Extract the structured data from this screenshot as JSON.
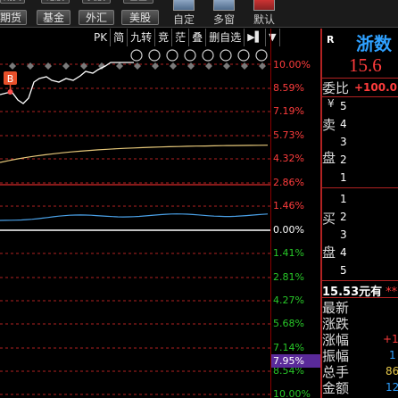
{
  "toolbar": {
    "top_buttons": [
      "期货",
      "港股",
      "美股",
      "基金"
    ],
    "market_buttons": [
      "期货",
      "基金",
      "外汇",
      "美股"
    ],
    "tools": [
      {
        "label": "自定",
        "icon": "custom-layout-icon"
      },
      {
        "label": "多窗",
        "icon": "multi-window-icon"
      },
      {
        "label": "默认",
        "icon": "default-layout-icon"
      }
    ]
  },
  "chart_tabs": [
    "PK",
    "简",
    "九转",
    "竞",
    "茫",
    "叠",
    "删自选",
    "▶▌",
    "▼"
  ],
  "chart_icons": [
    "eye-icon",
    "hand-icon",
    "play-icon",
    "undo-icon",
    "scissors-icon",
    "lock-icon",
    "zoom-in-icon",
    "zoom-out-icon"
  ],
  "marker_b": "B",
  "axis_pct_up": [
    "10.00%",
    "8.59%",
    "7.19%",
    "5.73%",
    "4.32%",
    "2.86%",
    "1.46%"
  ],
  "axis_pct_zero": "0.00%",
  "axis_pct_down": [
    "1.41%",
    "2.81%",
    "4.27%",
    "5.68%",
    "7.14%",
    "8.54%",
    "10.00%"
  ],
  "cursor_pct": "7.95%",
  "panel": {
    "r_label": "R",
    "stock_name": "浙数",
    "price": "15.6",
    "wei_bi_label": "委比",
    "wei_bi_value": "+100.0",
    "sell_labels": [
      "¥",
      "卖",
      "盘"
    ],
    "sell_levels": [
      "5",
      "4",
      "3",
      "2",
      "1"
    ],
    "buy_labels": [
      "买",
      "盘"
    ],
    "buy_levels": [
      "1",
      "2",
      "3",
      "4",
      "5"
    ],
    "limit_price": "15.53元有",
    "limit_stars": "**",
    "fields": [
      {
        "label": "最新",
        "value": ""
      },
      {
        "label": "涨跌",
        "value": ""
      },
      {
        "label": "涨幅",
        "value": "+1"
      },
      {
        "label": "振幅",
        "value": "1"
      },
      {
        "label": "总手",
        "value": "86"
      },
      {
        "label": "金额",
        "value": "12"
      }
    ]
  },
  "colors": {
    "up": "#ff3c3c",
    "down": "#28c828",
    "price_line": "#ffffff",
    "avg_line": "#e6c87a",
    "indicator_line": "#4aa0e6",
    "axis_dash": "#b22222"
  }
}
